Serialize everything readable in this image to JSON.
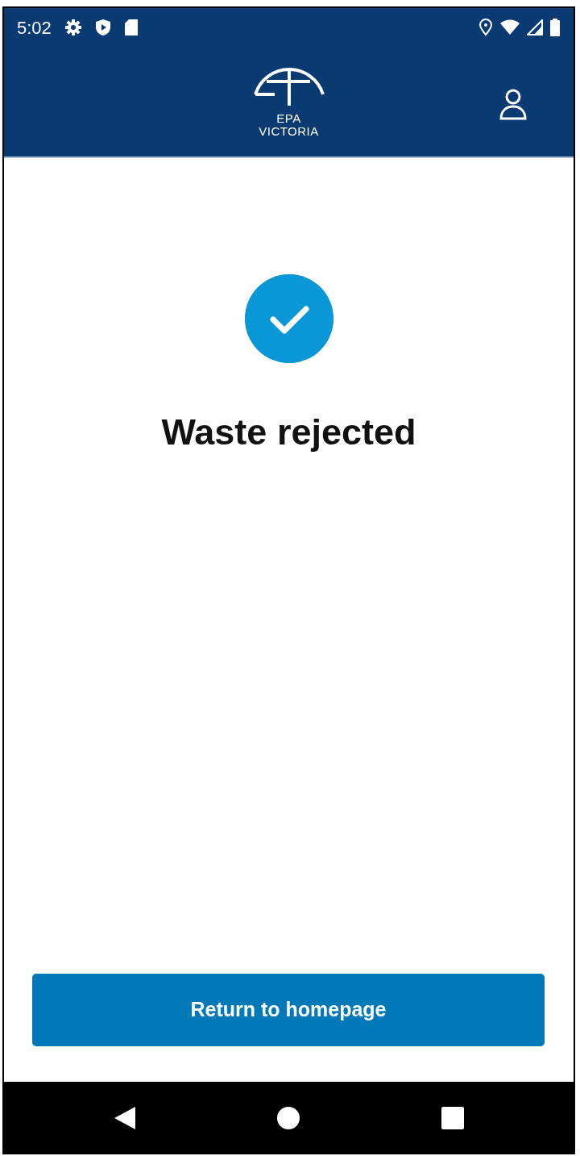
{
  "status_bar": {
    "time": "5:02"
  },
  "app_bar": {
    "logo_lines": [
      "EPA",
      "VICTORIA"
    ]
  },
  "result": {
    "title": "Waste rejected"
  },
  "button": {
    "label": "Return to homepage"
  }
}
